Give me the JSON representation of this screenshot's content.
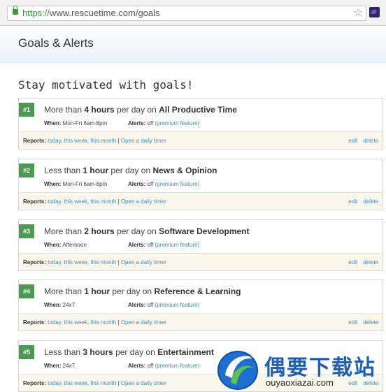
{
  "browser": {
    "url_protocol": "https://",
    "url_rest": "www.rescuetime.com/goals"
  },
  "page": {
    "title": "Goals & Alerts",
    "tagline": "Stay motivated with goals!"
  },
  "labels": {
    "when": "When:",
    "alerts": "Alerts:",
    "reports": "Reports:",
    "today": "today,",
    "this_week": "this week,",
    "this_month": "this month",
    "separator": "|",
    "daily_timer": "Open a daily timer",
    "edit": "edit",
    "delete": "delete",
    "per_day_on": "per day on"
  },
  "goals": [
    {
      "num": "#1",
      "comparison": "More than",
      "amount": "4 hours",
      "category": "All Productive Time",
      "when": "Mon-Fri 6am-8pm",
      "alert_status": "off",
      "alert_link": "(premium feature)"
    },
    {
      "num": "#2",
      "comparison": "Less than",
      "amount": "1 hour",
      "category": "News & Opinion",
      "when": "Mon-Fri 6am-8pm",
      "alert_status": "off",
      "alert_link": "(premium feature)"
    },
    {
      "num": "#3",
      "comparison": "More than",
      "amount": "2 hours",
      "category": "Software Development",
      "when": "Afternoon",
      "alert_status": "off",
      "alert_link": "(premium feature)"
    },
    {
      "num": "#4",
      "comparison": "More than",
      "amount": "1 hour",
      "category": "Reference & Learning",
      "when": "24x7",
      "alert_status": "off",
      "alert_link": "(premium feature)"
    },
    {
      "num": "#5",
      "comparison": "Less than",
      "amount": "3 hours",
      "category": "Entertainment",
      "when": "24x7",
      "alert_status": "off",
      "alert_link": "(premium feature)"
    }
  ],
  "watermark": {
    "title": "偶要下载站",
    "sub": "ouyaoxiazai.com"
  }
}
